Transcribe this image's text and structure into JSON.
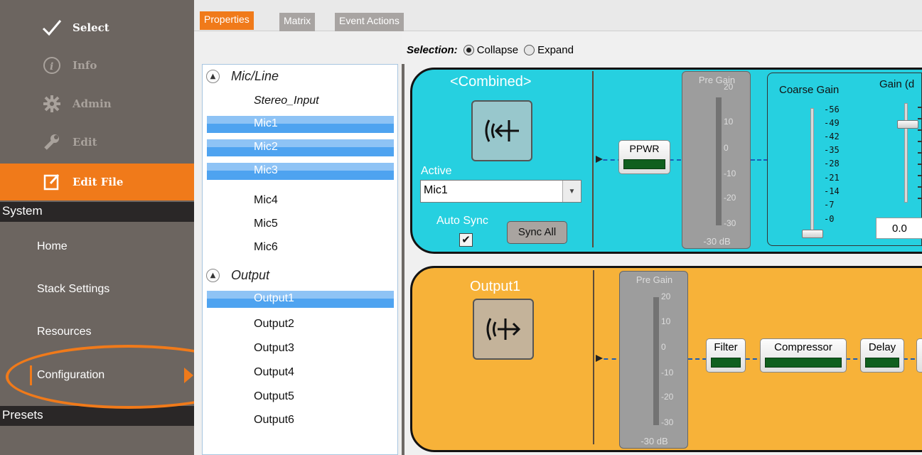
{
  "sidebar": {
    "top_items": [
      {
        "label": "Select",
        "icon": "checkmark-icon"
      },
      {
        "label": "Info",
        "icon": "info-icon"
      },
      {
        "label": "Admin",
        "icon": "gear-icon"
      },
      {
        "label": "Edit",
        "icon": "wrench-icon"
      },
      {
        "label": "Edit File",
        "icon": "edit-file-icon"
      }
    ],
    "system_header": "System",
    "system_items": [
      "Home",
      "Stack Settings",
      "Resources",
      "Configuration"
    ],
    "presets_header": "Presets",
    "accent_color": "#f07a1a"
  },
  "tabs": [
    "Properties",
    "Matrix",
    "Event Actions"
  ],
  "channels": {
    "groups": [
      {
        "label": "Mic/Line",
        "items": [
          "Stereo_Input",
          "Mic1",
          "Mic2",
          "Mic3",
          "Mic4",
          "Mic5",
          "Mic6"
        ]
      },
      {
        "label": "Output",
        "items": [
          "Output1",
          "Output2",
          "Output3",
          "Output4",
          "Output5",
          "Output6"
        ]
      }
    ],
    "selected": [
      "Mic1",
      "Mic2",
      "Mic3",
      "Output1"
    ]
  },
  "selection": {
    "label": "Selection:",
    "options": [
      "Collapse",
      "Expand"
    ],
    "selected": "Collapse"
  },
  "strip1": {
    "title": "<Combined>",
    "active_label": "Active",
    "active_value": "Mic1",
    "auto_sync_label": "Auto Sync",
    "auto_sync_checked": true,
    "sync_all_label": "Sync All",
    "ppwr_label": "PPWR",
    "pre_gain_title": "Pre Gain",
    "pre_gain_ticks": [
      "20",
      "10",
      "0",
      "-10",
      "-20",
      "-30"
    ],
    "pre_gain_value": "-30 dB",
    "coarse_gain_title": "Coarse Gain",
    "coarse_gain_ticks": [
      "56",
      "49",
      "42",
      "35",
      "28",
      "21",
      "14",
      "7",
      "0"
    ],
    "gain_title": "Gain  (d",
    "gain_value": "0.0",
    "color": "#26d0e0"
  },
  "strip2": {
    "title": "Output1",
    "pre_gain_title": "Pre Gain",
    "pre_gain_ticks": [
      "20",
      "10",
      "0",
      "-10",
      "-20",
      "-30"
    ],
    "pre_gain_value": "-30 dB",
    "modules": [
      "Filter",
      "Compressor",
      "Delay"
    ],
    "color": "#f7b239"
  }
}
